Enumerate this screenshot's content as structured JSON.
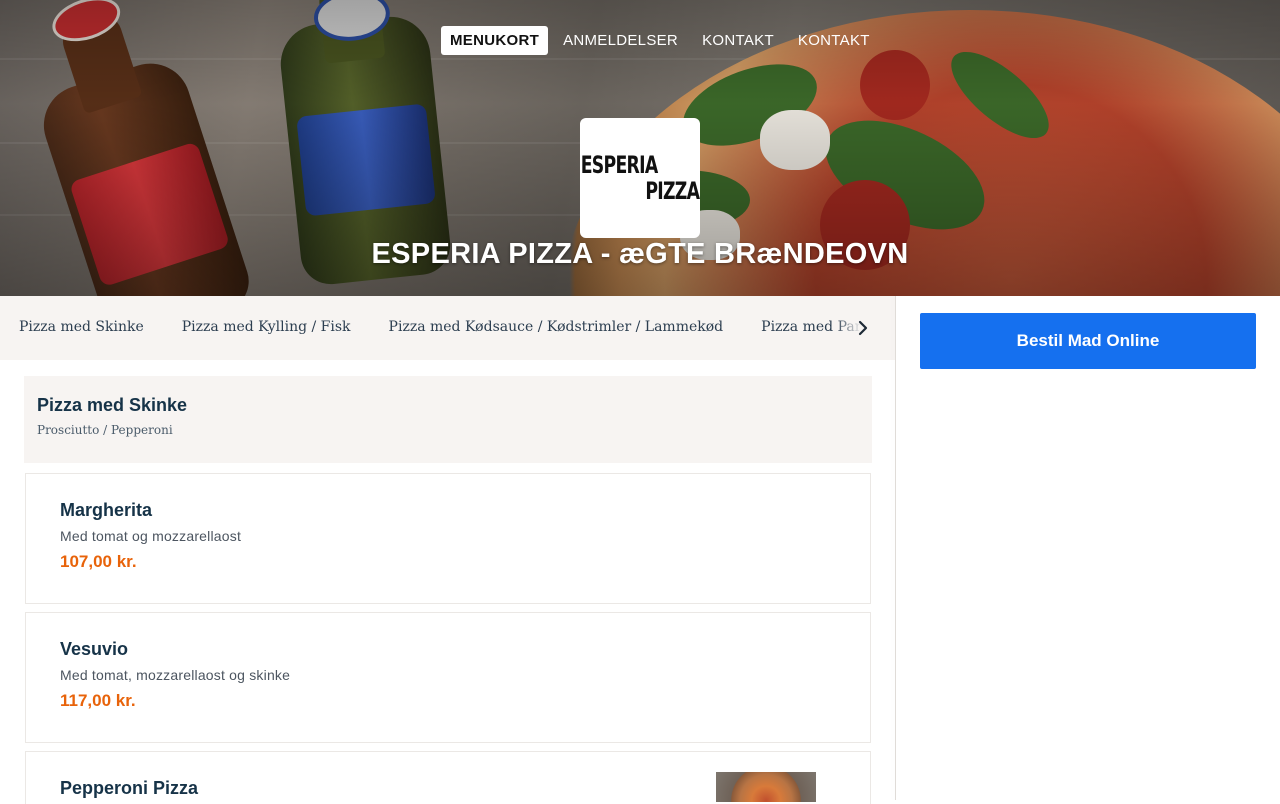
{
  "nav": {
    "items": [
      {
        "label": "MENUKORT",
        "active": true
      },
      {
        "label": "ANMELDELSER",
        "active": false
      },
      {
        "label": "KONTAKT",
        "active": false
      },
      {
        "label": "KONTAKT",
        "active": false
      }
    ]
  },
  "logo": {
    "line1": "ESPERIA",
    "line2": "PIZZA"
  },
  "hero": {
    "title": "ESPERIA PIZZA - æGTE BRæNDEOVN"
  },
  "categories": [
    "Pizza med Skinke",
    "Pizza med Kylling / Fisk",
    "Pizza med Kødsauce / Kødstrimler / Lammekød",
    "Pizza med Parmas"
  ],
  "icons": {
    "category_next": "chevron-right-icon"
  },
  "order": {
    "label": "Bestil Mad Online",
    "color": "#1570ef"
  },
  "section": {
    "title": "Pizza med Skinke",
    "subtitle": "Prosciutto / Pepperoni"
  },
  "items": [
    {
      "name": "Margherita",
      "description": "Med tomat og mozzarellaost",
      "price": "107,00 kr."
    },
    {
      "name": "Vesuvio",
      "description": "Med tomat, mozzarellaost og skinke",
      "price": "117,00 kr."
    },
    {
      "name": "Pepperoni Pizza",
      "description": "",
      "price": ""
    }
  ],
  "colors": {
    "price": "#e8630a",
    "heading": "#163348",
    "panel": "#f7f4f2"
  }
}
